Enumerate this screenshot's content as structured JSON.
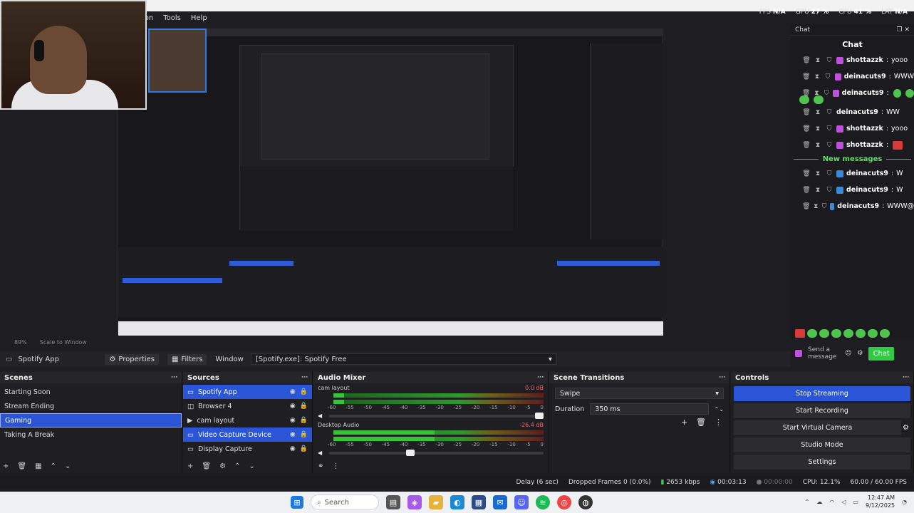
{
  "menu": [
    "Tools",
    "Help"
  ],
  "menu_partial": "ion",
  "stats": [
    {
      "label": "FPS",
      "value": "N/A"
    },
    {
      "label": "GPU",
      "value": "27 %"
    },
    {
      "label": "CPU",
      "value": "41 %"
    },
    {
      "label": "LAT",
      "value": "N/A"
    }
  ],
  "chat": {
    "tab": "Chat",
    "title": "Chat",
    "messages": [
      {
        "user": "shottazzk",
        "text": "yooo",
        "badge": "p",
        "emotes": 0
      },
      {
        "user": "deinacuts9",
        "text": "WWW",
        "badge": "p",
        "emotes": 0
      },
      {
        "user": "deinacuts9",
        "text": "",
        "badge": "p",
        "emotes": 2
      },
      {
        "user": "",
        "text": "",
        "badge": "",
        "emotes": 2
      },
      {
        "user": "deinacuts9",
        "text": "WW",
        "badge": "",
        "emotes": 0
      },
      {
        "user": "shottazzk",
        "text": "yooo",
        "badge": "p",
        "emotes": 0
      },
      {
        "user": "shottazzk",
        "text": "",
        "badge": "p",
        "emotes": 1
      }
    ],
    "new_messages": "New messages",
    "messages_after": [
      {
        "user": "deinacuts9",
        "text": "W",
        "badge": "b"
      },
      {
        "user": "deinacuts9",
        "text": "W",
        "badge": "b"
      },
      {
        "user": "deinacuts9",
        "text": "WWW@",
        "badge": "b"
      }
    ],
    "input_placeholder": "Send a message",
    "send_label": "Chat"
  },
  "zoom": {
    "level": "89%",
    "mode": "Scale to Window"
  },
  "context_bar": {
    "source": "Spotify App",
    "properties": "Properties",
    "filters": "Filters",
    "window_label": "Window",
    "window_value": "[Spotify.exe]: Spotify Free"
  },
  "scenes": {
    "title": "Scenes",
    "items": [
      "Starting Soon",
      "Stream Ending",
      "Gaming",
      "Taking A Break"
    ],
    "selected": 2
  },
  "sources": {
    "title": "Sources",
    "items": [
      {
        "name": "Spotify App",
        "selected": true
      },
      {
        "name": "Browser 4",
        "selected": false
      },
      {
        "name": "cam layout",
        "selected": false
      },
      {
        "name": "Video Capture Device",
        "selected": true
      },
      {
        "name": "Display Capture",
        "selected": false
      }
    ]
  },
  "mixer": {
    "title": "Audio Mixer",
    "channels": [
      {
        "name": "cam layout",
        "db": "0.0 dB",
        "level": 0.05,
        "volume": 1.0
      },
      {
        "name": "Desktop Audio",
        "db": "-26.4 dB",
        "level": 0.48,
        "volume": 0.4
      }
    ],
    "ticks": [
      "-60",
      "-55",
      "-50",
      "-45",
      "-40",
      "-35",
      "-30",
      "-25",
      "-20",
      "-15",
      "-10",
      "-5",
      "0"
    ]
  },
  "transitions": {
    "title": "Scene Transitions",
    "selected": "Swipe",
    "duration_label": "Duration",
    "duration_value": "350 ms"
  },
  "controls": {
    "title": "Controls",
    "buttons": [
      "Stop Streaming",
      "Start Recording",
      "Start Virtual Camera",
      "Studio Mode",
      "Settings"
    ]
  },
  "status": {
    "delay": "Delay (6 sec)",
    "dropped": "Dropped Frames 0 (0.0%)",
    "kbps": "2653 kbps",
    "stream_time": "00:03:13",
    "rec_time": "00:00:00",
    "cpu": "CPU: 12.1%",
    "fps": "60.00 / 60.00 FPS"
  },
  "taskbar": {
    "search": "Search",
    "time": "12:47 AM",
    "date": "9/12/2025"
  },
  "colors": {
    "accent": "#2a55d6",
    "chat_green": "#2ecc40"
  }
}
